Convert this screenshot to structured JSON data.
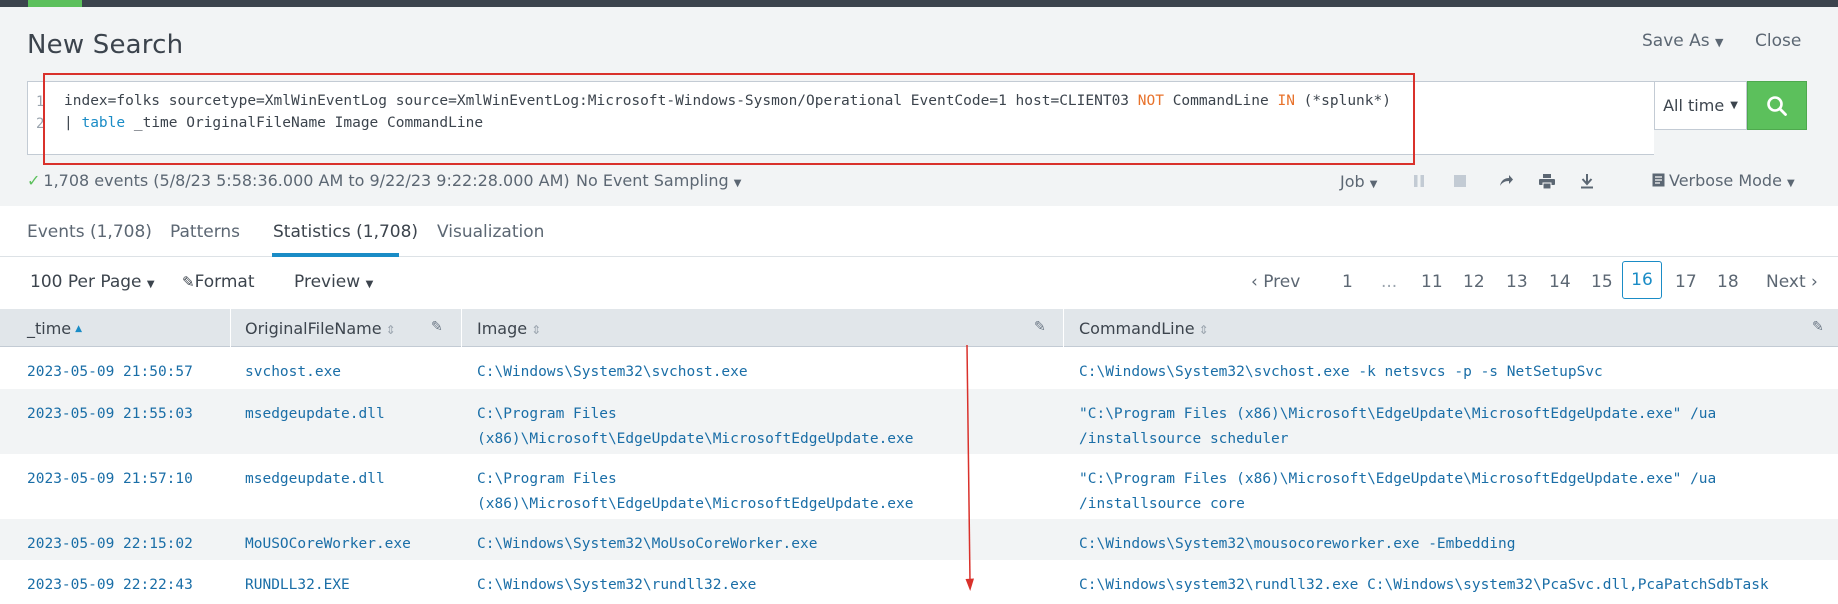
{
  "page": {
    "title": "New Search",
    "save_as_label": "Save As",
    "close_label": "Close"
  },
  "search": {
    "line_numbers": [
      "1",
      "2"
    ],
    "line1": {
      "part1": "index=folks sourcetype=XmlWinEventLog source=XmlWinEventLog:Microsoft-Windows-Sysmon/Operational EventCode=1 host=CLIENT03 ",
      "not_kw": "NOT",
      "part2": " CommandLine ",
      "in_kw": "IN",
      "part3": " (*splunk*)"
    },
    "line2": {
      "pipe": "| ",
      "table_kw": "table",
      "rest": " _time OriginalFileName Image CommandLine"
    },
    "time_range_label": "All time",
    "search_icon": "search-icon"
  },
  "status": {
    "check_icon": "check-icon",
    "events_summary": "1,708 events (5/8/23 5:58:36.000 AM to 9/22/23 9:22:28.000 AM)",
    "sampling_label": "No Event Sampling",
    "job_label": "Job",
    "job_icons": [
      "pause-icon",
      "stop-icon",
      "share-icon",
      "print-icon",
      "export-icon"
    ],
    "mode_label": "Verbose Mode"
  },
  "tabs": [
    {
      "label": "Events (1,708)"
    },
    {
      "label": "Patterns"
    },
    {
      "label": "Statistics (1,708)",
      "active": true
    },
    {
      "label": "Visualization"
    }
  ],
  "controls": {
    "per_page_label": "100 Per Page",
    "format_label": "Format",
    "preview_label": "Preview"
  },
  "pagination": {
    "prev_label": "Prev",
    "next_label": "Next",
    "first": "1",
    "ellipsis": "...",
    "pages": [
      "11",
      "12",
      "13",
      "14",
      "15"
    ],
    "current": "16",
    "after": [
      "17",
      "18"
    ]
  },
  "table": {
    "columns": [
      "_time",
      "OriginalFileName",
      "Image",
      "CommandLine"
    ],
    "rows": [
      {
        "time": "2023-05-09 21:50:57",
        "original": "svchost.exe",
        "image": [
          "C:\\Windows\\System32\\svchost.exe"
        ],
        "cmd": [
          "C:\\Windows\\System32\\svchost.exe -k netsvcs -p -s NetSetupSvc"
        ]
      },
      {
        "time": "2023-05-09 21:55:03",
        "original": "msedgeupdate.dll",
        "image": [
          "C:\\Program Files",
          "(x86)\\Microsoft\\EdgeUpdate\\MicrosoftEdgeUpdate.exe"
        ],
        "cmd": [
          "\"C:\\Program Files (x86)\\Microsoft\\EdgeUpdate\\MicrosoftEdgeUpdate.exe\" /ua",
          "/installsource scheduler"
        ]
      },
      {
        "time": "2023-05-09 21:57:10",
        "original": "msedgeupdate.dll",
        "image": [
          "C:\\Program Files",
          "(x86)\\Microsoft\\EdgeUpdate\\MicrosoftEdgeUpdate.exe"
        ],
        "cmd": [
          "\"C:\\Program Files (x86)\\Microsoft\\EdgeUpdate\\MicrosoftEdgeUpdate.exe\" /ua",
          "/installsource core"
        ]
      },
      {
        "time": "2023-05-09 22:15:02",
        "original": "MoUSOCoreWorker.exe",
        "image": [
          "C:\\Windows\\System32\\MoUsoCoreWorker.exe"
        ],
        "cmd": [
          "C:\\Windows\\System32\\mousocoreworker.exe -Embedding"
        ]
      },
      {
        "time": "2023-05-09 22:22:43",
        "original": "RUNDLL32.EXE",
        "image": [
          "C:\\Windows\\System32\\rundll32.exe"
        ],
        "cmd": [
          "C:\\Windows\\system32\\rundll32.exe C:\\Windows\\system32\\PcaSvc.dll,PcaPatchSdbTask"
        ]
      }
    ]
  },
  "colors": {
    "accent_green": "#5cc05c",
    "link_blue": "#1a6ea7",
    "highlight_red": "#d9312b",
    "keyword_orange": "#e8722b"
  }
}
